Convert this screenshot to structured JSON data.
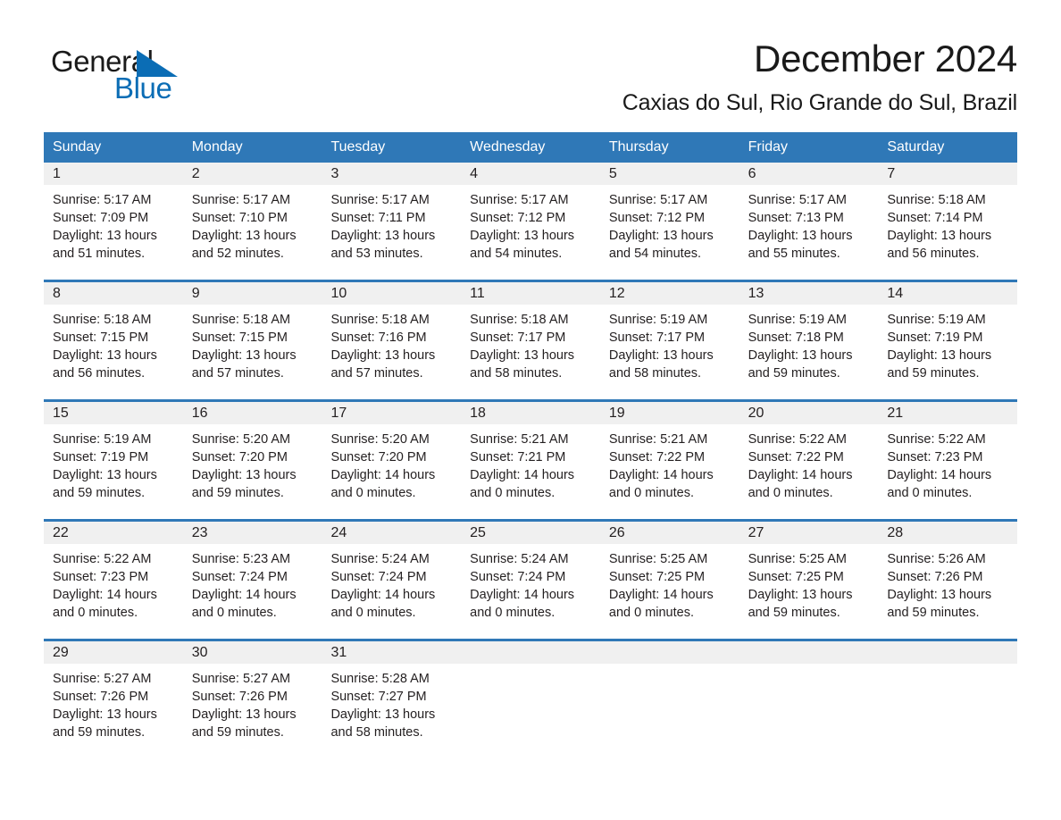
{
  "brand": {
    "name_part1": "General",
    "name_part2": "Blue",
    "flag_icon": "triangle-flag-icon",
    "accent_color": "#0b6db5"
  },
  "header": {
    "title": "December 2024",
    "location": "Caxias do Sul, Rio Grande do Sul, Brazil"
  },
  "theme": {
    "header_blue": "#2f78b7",
    "day_band_gray": "#f0f0f0",
    "text": "#231f20"
  },
  "calendar": {
    "weekdays": [
      "Sunday",
      "Monday",
      "Tuesday",
      "Wednesday",
      "Thursday",
      "Friday",
      "Saturday"
    ],
    "weeks": [
      [
        {
          "day": "1",
          "sunrise": "Sunrise: 5:17 AM",
          "sunset": "Sunset: 7:09 PM",
          "daylight_line1": "Daylight: 13 hours",
          "daylight_line2": "and 51 minutes."
        },
        {
          "day": "2",
          "sunrise": "Sunrise: 5:17 AM",
          "sunset": "Sunset: 7:10 PM",
          "daylight_line1": "Daylight: 13 hours",
          "daylight_line2": "and 52 minutes."
        },
        {
          "day": "3",
          "sunrise": "Sunrise: 5:17 AM",
          "sunset": "Sunset: 7:11 PM",
          "daylight_line1": "Daylight: 13 hours",
          "daylight_line2": "and 53 minutes."
        },
        {
          "day": "4",
          "sunrise": "Sunrise: 5:17 AM",
          "sunset": "Sunset: 7:12 PM",
          "daylight_line1": "Daylight: 13 hours",
          "daylight_line2": "and 54 minutes."
        },
        {
          "day": "5",
          "sunrise": "Sunrise: 5:17 AM",
          "sunset": "Sunset: 7:12 PM",
          "daylight_line1": "Daylight: 13 hours",
          "daylight_line2": "and 54 minutes."
        },
        {
          "day": "6",
          "sunrise": "Sunrise: 5:17 AM",
          "sunset": "Sunset: 7:13 PM",
          "daylight_line1": "Daylight: 13 hours",
          "daylight_line2": "and 55 minutes."
        },
        {
          "day": "7",
          "sunrise": "Sunrise: 5:18 AM",
          "sunset": "Sunset: 7:14 PM",
          "daylight_line1": "Daylight: 13 hours",
          "daylight_line2": "and 56 minutes."
        }
      ],
      [
        {
          "day": "8",
          "sunrise": "Sunrise: 5:18 AM",
          "sunset": "Sunset: 7:15 PM",
          "daylight_line1": "Daylight: 13 hours",
          "daylight_line2": "and 56 minutes."
        },
        {
          "day": "9",
          "sunrise": "Sunrise: 5:18 AM",
          "sunset": "Sunset: 7:15 PM",
          "daylight_line1": "Daylight: 13 hours",
          "daylight_line2": "and 57 minutes."
        },
        {
          "day": "10",
          "sunrise": "Sunrise: 5:18 AM",
          "sunset": "Sunset: 7:16 PM",
          "daylight_line1": "Daylight: 13 hours",
          "daylight_line2": "and 57 minutes."
        },
        {
          "day": "11",
          "sunrise": "Sunrise: 5:18 AM",
          "sunset": "Sunset: 7:17 PM",
          "daylight_line1": "Daylight: 13 hours",
          "daylight_line2": "and 58 minutes."
        },
        {
          "day": "12",
          "sunrise": "Sunrise: 5:19 AM",
          "sunset": "Sunset: 7:17 PM",
          "daylight_line1": "Daylight: 13 hours",
          "daylight_line2": "and 58 minutes."
        },
        {
          "day": "13",
          "sunrise": "Sunrise: 5:19 AM",
          "sunset": "Sunset: 7:18 PM",
          "daylight_line1": "Daylight: 13 hours",
          "daylight_line2": "and 59 minutes."
        },
        {
          "day": "14",
          "sunrise": "Sunrise: 5:19 AM",
          "sunset": "Sunset: 7:19 PM",
          "daylight_line1": "Daylight: 13 hours",
          "daylight_line2": "and 59 minutes."
        }
      ],
      [
        {
          "day": "15",
          "sunrise": "Sunrise: 5:19 AM",
          "sunset": "Sunset: 7:19 PM",
          "daylight_line1": "Daylight: 13 hours",
          "daylight_line2": "and 59 minutes."
        },
        {
          "day": "16",
          "sunrise": "Sunrise: 5:20 AM",
          "sunset": "Sunset: 7:20 PM",
          "daylight_line1": "Daylight: 13 hours",
          "daylight_line2": "and 59 minutes."
        },
        {
          "day": "17",
          "sunrise": "Sunrise: 5:20 AM",
          "sunset": "Sunset: 7:20 PM",
          "daylight_line1": "Daylight: 14 hours",
          "daylight_line2": "and 0 minutes."
        },
        {
          "day": "18",
          "sunrise": "Sunrise: 5:21 AM",
          "sunset": "Sunset: 7:21 PM",
          "daylight_line1": "Daylight: 14 hours",
          "daylight_line2": "and 0 minutes."
        },
        {
          "day": "19",
          "sunrise": "Sunrise: 5:21 AM",
          "sunset": "Sunset: 7:22 PM",
          "daylight_line1": "Daylight: 14 hours",
          "daylight_line2": "and 0 minutes."
        },
        {
          "day": "20",
          "sunrise": "Sunrise: 5:22 AM",
          "sunset": "Sunset: 7:22 PM",
          "daylight_line1": "Daylight: 14 hours",
          "daylight_line2": "and 0 minutes."
        },
        {
          "day": "21",
          "sunrise": "Sunrise: 5:22 AM",
          "sunset": "Sunset: 7:23 PM",
          "daylight_line1": "Daylight: 14 hours",
          "daylight_line2": "and 0 minutes."
        }
      ],
      [
        {
          "day": "22",
          "sunrise": "Sunrise: 5:22 AM",
          "sunset": "Sunset: 7:23 PM",
          "daylight_line1": "Daylight: 14 hours",
          "daylight_line2": "and 0 minutes."
        },
        {
          "day": "23",
          "sunrise": "Sunrise: 5:23 AM",
          "sunset": "Sunset: 7:24 PM",
          "daylight_line1": "Daylight: 14 hours",
          "daylight_line2": "and 0 minutes."
        },
        {
          "day": "24",
          "sunrise": "Sunrise: 5:24 AM",
          "sunset": "Sunset: 7:24 PM",
          "daylight_line1": "Daylight: 14 hours",
          "daylight_line2": "and 0 minutes."
        },
        {
          "day": "25",
          "sunrise": "Sunrise: 5:24 AM",
          "sunset": "Sunset: 7:24 PM",
          "daylight_line1": "Daylight: 14 hours",
          "daylight_line2": "and 0 minutes."
        },
        {
          "day": "26",
          "sunrise": "Sunrise: 5:25 AM",
          "sunset": "Sunset: 7:25 PM",
          "daylight_line1": "Daylight: 14 hours",
          "daylight_line2": "and 0 minutes."
        },
        {
          "day": "27",
          "sunrise": "Sunrise: 5:25 AM",
          "sunset": "Sunset: 7:25 PM",
          "daylight_line1": "Daylight: 13 hours",
          "daylight_line2": "and 59 minutes."
        },
        {
          "day": "28",
          "sunrise": "Sunrise: 5:26 AM",
          "sunset": "Sunset: 7:26 PM",
          "daylight_line1": "Daylight: 13 hours",
          "daylight_line2": "and 59 minutes."
        }
      ],
      [
        {
          "day": "29",
          "sunrise": "Sunrise: 5:27 AM",
          "sunset": "Sunset: 7:26 PM",
          "daylight_line1": "Daylight: 13 hours",
          "daylight_line2": "and 59 minutes."
        },
        {
          "day": "30",
          "sunrise": "Sunrise: 5:27 AM",
          "sunset": "Sunset: 7:26 PM",
          "daylight_line1": "Daylight: 13 hours",
          "daylight_line2": "and 59 minutes."
        },
        {
          "day": "31",
          "sunrise": "Sunrise: 5:28 AM",
          "sunset": "Sunset: 7:27 PM",
          "daylight_line1": "Daylight: 13 hours",
          "daylight_line2": "and 58 minutes."
        },
        {
          "day": "",
          "sunrise": "",
          "sunset": "",
          "daylight_line1": "",
          "daylight_line2": ""
        },
        {
          "day": "",
          "sunrise": "",
          "sunset": "",
          "daylight_line1": "",
          "daylight_line2": ""
        },
        {
          "day": "",
          "sunrise": "",
          "sunset": "",
          "daylight_line1": "",
          "daylight_line2": ""
        },
        {
          "day": "",
          "sunrise": "",
          "sunset": "",
          "daylight_line1": "",
          "daylight_line2": ""
        }
      ]
    ]
  }
}
